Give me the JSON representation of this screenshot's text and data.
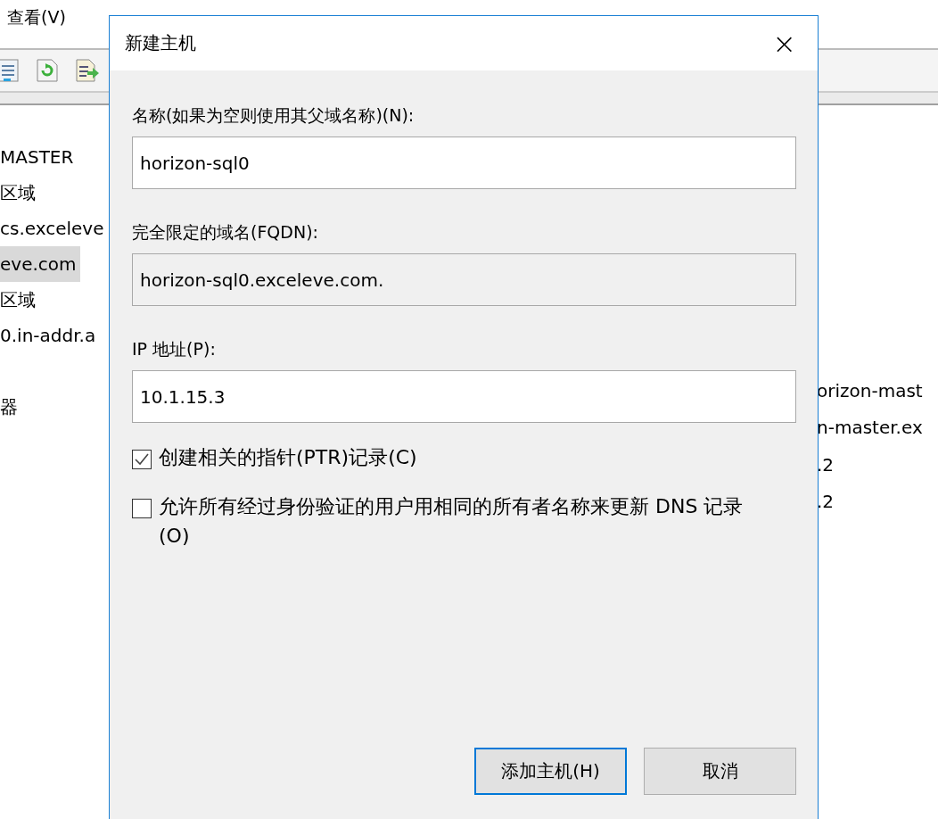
{
  "menu": [
    {
      "label": "查看(V)"
    }
  ],
  "tree": [
    {
      "label": "MASTER",
      "selected": false
    },
    {
      "label": "区域",
      "selected": false
    },
    {
      "label": "cs.exceleve",
      "selected": false
    },
    {
      "label": "eve.com",
      "selected": true
    },
    {
      "label": "区域",
      "selected": false
    },
    {
      "label": "0.in-addr.a",
      "selected": false
    },
    {
      "label": "器",
      "selected": false
    }
  ],
  "list": [
    "orizon-mast",
    "n-master.ex",
    ".2",
    ".2"
  ],
  "dialog": {
    "title": "新建主机",
    "close": "×",
    "fields": [
      {
        "label": "名称(如果为空则使用其父域名称)(N):",
        "value": "horizon-sql0",
        "readonly": false
      },
      {
        "label": "完全限定的域名(FQDN):",
        "value": "horizon-sql0.exceleve.com.",
        "readonly": true
      },
      {
        "label": "IP 地址(P):",
        "value": "10.1.15.3",
        "readonly": false
      }
    ],
    "checkboxes": [
      {
        "label": "创建相关的指针(PTR)记录(C)",
        "checked": true
      },
      {
        "label": "允许所有经过身份验证的用户用相同的所有者名称来更新 DNS 记录(O)",
        "checked": false
      }
    ],
    "buttons": [
      {
        "label": "添加主机(H)",
        "default": true
      },
      {
        "label": "取消",
        "default": false
      }
    ]
  }
}
